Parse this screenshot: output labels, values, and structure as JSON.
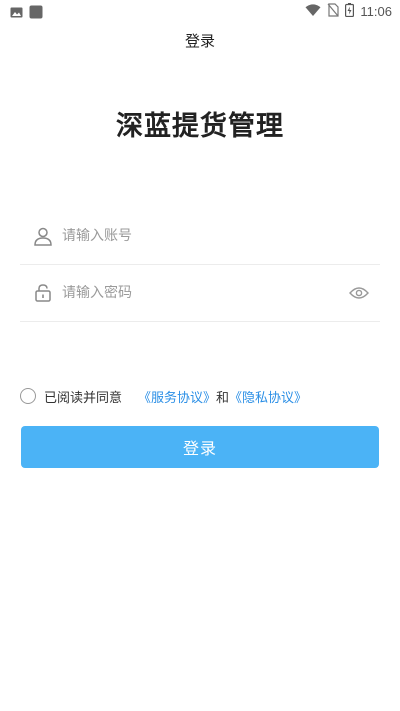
{
  "status_bar": {
    "time": "11:06",
    "left_icons": [
      "image-icon",
      "app-square-icon"
    ],
    "right_icons": [
      "wifi-icon",
      "no-sim-icon",
      "battery-icon"
    ]
  },
  "title_bar": {
    "title": "登录"
  },
  "app": {
    "name": "深蓝提货管理"
  },
  "form": {
    "account": {
      "placeholder": "请输入账号",
      "value": "",
      "icon": "user-icon"
    },
    "password": {
      "placeholder": "请输入密码",
      "value": "",
      "icon": "lock-icon",
      "toggle_icon": "eye-icon"
    }
  },
  "agreement": {
    "checked": false,
    "prefix": "已阅读并同意",
    "service_link": "《服务协议》",
    "conjunction": "和",
    "privacy_link": "《隐私协议》"
  },
  "login_button": {
    "label": "登录"
  },
  "colors": {
    "accent": "#4bb3f6",
    "link": "#2b8fe6",
    "title_text": "#222222",
    "placeholder": "#9a9a9a"
  }
}
